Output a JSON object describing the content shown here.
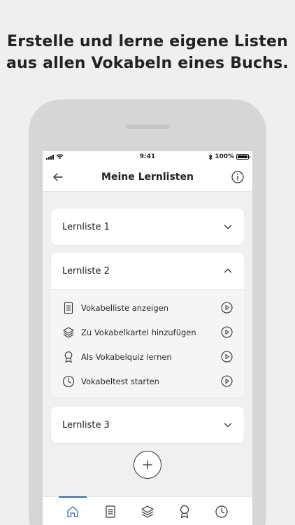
{
  "headline": {
    "line1": "Erstelle und lerne eigene Listen",
    "line2": "aus allen Vokabeln eines Buchs."
  },
  "status_bar": {
    "time": "9:41",
    "battery": "100%"
  },
  "nav": {
    "title": "Meine Lernlisten",
    "back_icon": "arrow-left-icon",
    "info_icon": "info-icon"
  },
  "lists": [
    {
      "title": "Lernliste 1",
      "expanded": false
    },
    {
      "title": "Lernliste 2",
      "expanded": true,
      "actions": [
        {
          "label": "Vokabelliste anzeigen",
          "icon": "document-icon"
        },
        {
          "label": "Zu Vokabelkartei hinzufügen",
          "icon": "layers-icon"
        },
        {
          "label": "Als Vokabelquiz lernen",
          "icon": "award-icon"
        },
        {
          "label": "Vokabeltest starten",
          "icon": "clock-icon"
        }
      ]
    },
    {
      "title": "Lernliste 3",
      "expanded": false
    }
  ],
  "tabs": [
    {
      "icon": "home-icon",
      "active": true
    },
    {
      "icon": "document-icon",
      "active": false
    },
    {
      "icon": "layers-icon",
      "active": false
    },
    {
      "icon": "award-icon",
      "active": false
    },
    {
      "icon": "clock-icon",
      "active": false
    }
  ],
  "colors": {
    "accent": "#2c6bb5",
    "background": "#efefef",
    "phone_frame": "#d6d6d6"
  }
}
